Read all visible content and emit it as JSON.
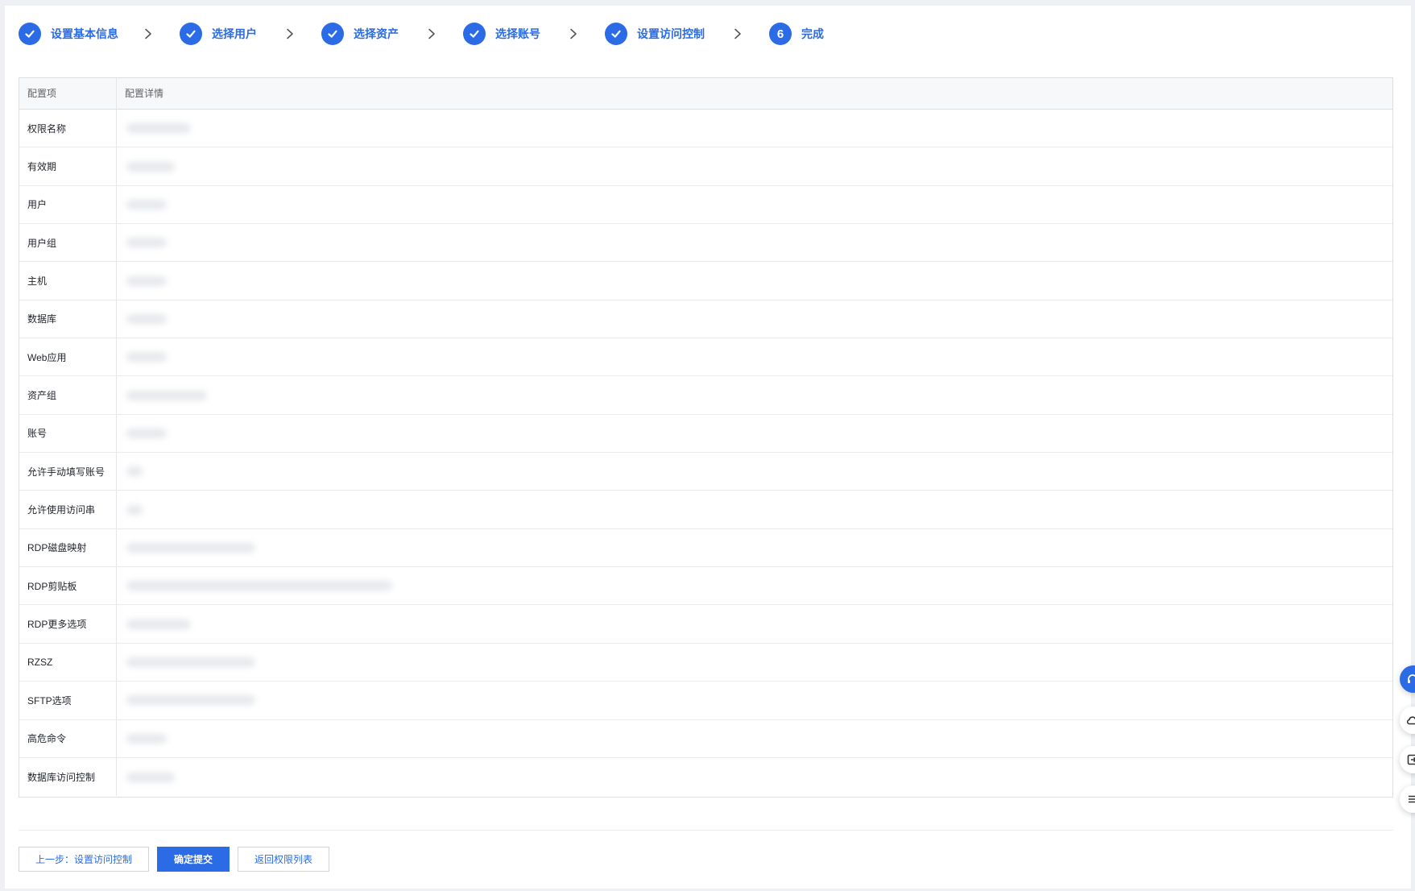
{
  "steps": [
    {
      "label": "设置基本信息",
      "done": true
    },
    {
      "label": "选择用户",
      "done": true
    },
    {
      "label": "选择资产",
      "done": true
    },
    {
      "label": "选择账号",
      "done": true
    },
    {
      "label": "设置访问控制",
      "done": true
    },
    {
      "label": "完成",
      "done": false,
      "number": "6"
    }
  ],
  "table": {
    "headers": [
      "配置项",
      "配置详情"
    ],
    "rows": [
      {
        "item": "权限名称"
      },
      {
        "item": "有效期"
      },
      {
        "item": "用户"
      },
      {
        "item": "用户组"
      },
      {
        "item": "主机"
      },
      {
        "item": "数据库"
      },
      {
        "item": "Web应用"
      },
      {
        "item": "资产组"
      },
      {
        "item": "账号"
      },
      {
        "item": "允许手动填写账号"
      },
      {
        "item": "允许使用访问串"
      },
      {
        "item": "RDP磁盘映射"
      },
      {
        "item": "RDP剪贴板"
      },
      {
        "item": "RDP更多选项"
      },
      {
        "item": "RZSZ"
      },
      {
        "item": "SFTP选项"
      },
      {
        "item": "高危命令"
      },
      {
        "item": "数据库访问控制"
      }
    ]
  },
  "footer": {
    "prev_label": "上一步：设置访问控制",
    "submit_label": "确定提交",
    "back_label": "返回权限列表"
  },
  "colors": {
    "accent": "#2b6be6"
  },
  "float_toolbar": [
    "headset-icon",
    "cloud-icon",
    "export-icon",
    "menu-icon"
  ]
}
